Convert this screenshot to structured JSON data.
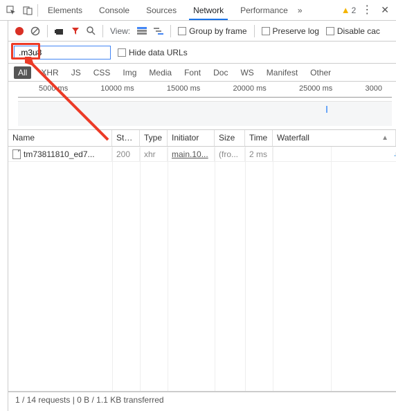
{
  "tabs": {
    "items": [
      "Elements",
      "Console",
      "Sources",
      "Network",
      "Performance"
    ],
    "active": "Network",
    "warning_count": "2"
  },
  "toolbar": {
    "view_label": "View:",
    "group_by_frame": "Group by frame",
    "preserve_log": "Preserve log",
    "disable_cache": "Disable cac"
  },
  "filter": {
    "value": ".m3u8",
    "hide_data_urls": "Hide data URLs"
  },
  "type_tabs": [
    "All",
    "XHR",
    "JS",
    "CSS",
    "Img",
    "Media",
    "Font",
    "Doc",
    "WS",
    "Manifest",
    "Other"
  ],
  "timeline": {
    "ticks": [
      "5000 ms",
      "10000 ms",
      "15000 ms",
      "20000 ms",
      "25000 ms",
      "3000"
    ]
  },
  "columns": {
    "name": "Name",
    "status": "Stat...",
    "type": "Type",
    "initiator": "Initiator",
    "size": "Size",
    "time": "Time",
    "waterfall": "Waterfall"
  },
  "rows": [
    {
      "name": "tm73811810_ed7...",
      "status": "200",
      "type": "xhr",
      "initiator": "main.10...",
      "size": "(fro...",
      "time": "2 ms"
    }
  ],
  "status_bar": "1 / 14 requests  |  0 B / 1.1 KB transferred"
}
